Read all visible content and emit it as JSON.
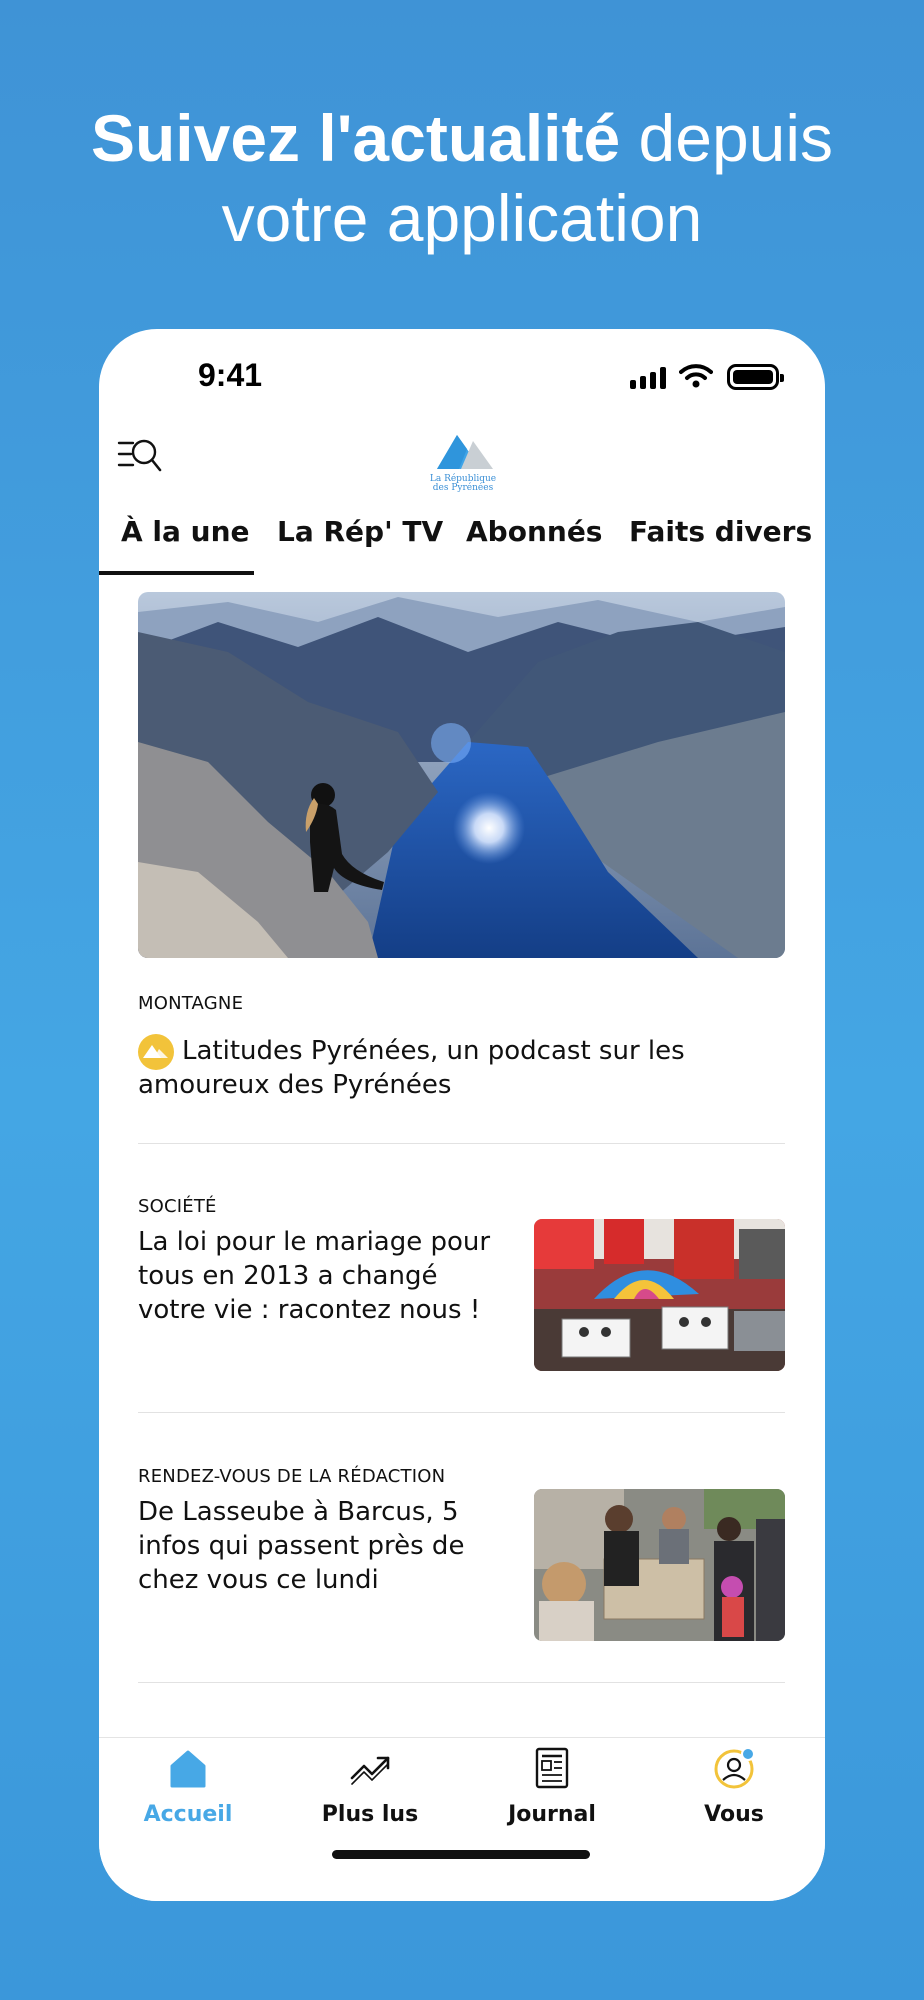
{
  "promo": {
    "headline_bold": "Suivez l'actualité",
    "headline_rest": " depuis",
    "headline_line2": "votre application"
  },
  "status_bar": {
    "time": "9:41"
  },
  "app": {
    "logo_text": "La République des Pyrénées",
    "tabs": [
      {
        "label": "À la une",
        "active": true
      },
      {
        "label": "La Rép' TV",
        "active": false
      },
      {
        "label": "Abonnés",
        "active": false
      },
      {
        "label": "Faits divers",
        "active": false
      }
    ]
  },
  "articles": [
    {
      "category": "MONTAGNE",
      "title": "Latitudes Pyrénées, un podcast sur les amoureux des Pyrénées",
      "premium": true
    },
    {
      "category": "SOCIÉTÉ",
      "title": "La loi pour le mariage pour tous en 2013 a changé votre vie : racontez nous !"
    },
    {
      "category": "RENDEZ-VOUS DE LA RÉDACTION",
      "title": "De Lasseube à Barcus, 5 infos qui passent près de chez vous ce lundi"
    }
  ],
  "bottom_nav": [
    {
      "label": "Accueil",
      "icon": "home-icon",
      "active": true
    },
    {
      "label": "Plus lus",
      "icon": "trending-icon",
      "active": false
    },
    {
      "label": "Journal",
      "icon": "newspaper-icon",
      "active": false
    },
    {
      "label": "Vous",
      "icon": "user-icon",
      "active": false
    }
  ],
  "colors": {
    "background": "#42a0e0",
    "accent": "#47a8e6",
    "premium_badge": "#f2c33a"
  }
}
